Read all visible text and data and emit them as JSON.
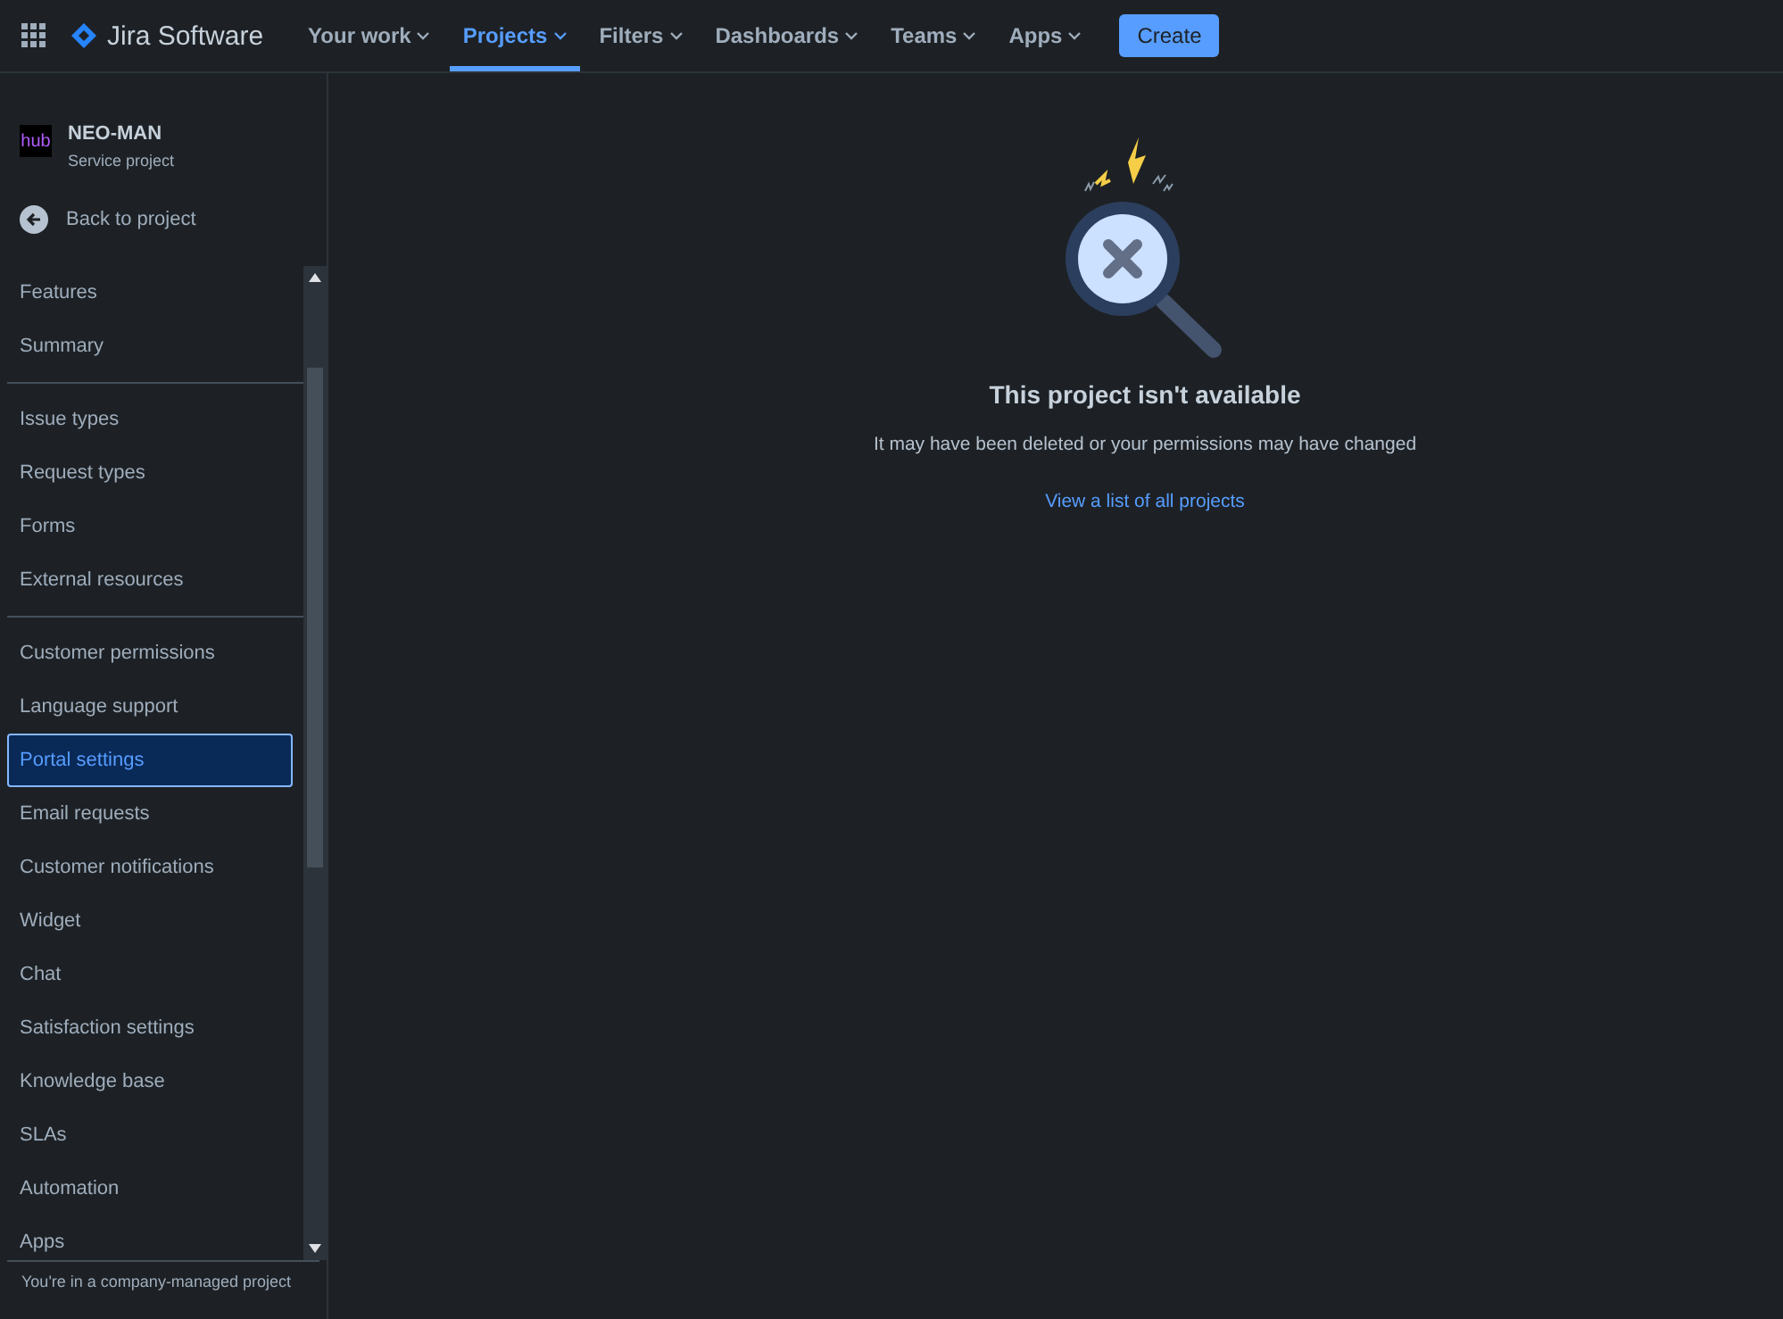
{
  "topbar": {
    "product": "Jira Software",
    "nav": [
      {
        "label": "Your work",
        "selected": false
      },
      {
        "label": "Projects",
        "selected": true
      },
      {
        "label": "Filters",
        "selected": false
      },
      {
        "label": "Dashboards",
        "selected": false
      },
      {
        "label": "Teams",
        "selected": false
      },
      {
        "label": "Apps",
        "selected": false
      }
    ],
    "create_button": "Create"
  },
  "sidebar": {
    "project": {
      "name": "NEO-MAN",
      "type": "Service project",
      "logo_text": "hub"
    },
    "back_link": "Back to project",
    "groups": [
      [
        {
          "label": "Features",
          "selected": false
        },
        {
          "label": "Summary",
          "selected": false
        }
      ],
      [
        {
          "label": "Issue types",
          "selected": false
        },
        {
          "label": "Request types",
          "selected": false
        },
        {
          "label": "Forms",
          "selected": false
        },
        {
          "label": "External resources",
          "selected": false
        }
      ],
      [
        {
          "label": "Customer permissions",
          "selected": false
        },
        {
          "label": "Language support",
          "selected": false
        },
        {
          "label": "Portal settings",
          "selected": true
        },
        {
          "label": "Email requests",
          "selected": false
        },
        {
          "label": "Customer notifications",
          "selected": false
        },
        {
          "label": "Widget",
          "selected": false
        },
        {
          "label": "Chat",
          "selected": false
        },
        {
          "label": "Satisfaction settings",
          "selected": false
        },
        {
          "label": "Knowledge base",
          "selected": false
        },
        {
          "label": "SLAs",
          "selected": false
        },
        {
          "label": "Automation",
          "selected": false
        },
        {
          "label": "Apps",
          "selected": false
        }
      ]
    ],
    "footer": "You're in a company-managed project"
  },
  "main": {
    "title": "This project isn't available",
    "message": "It may have been deleted or your permissions may have changed",
    "link": "View a list of all projects"
  }
}
